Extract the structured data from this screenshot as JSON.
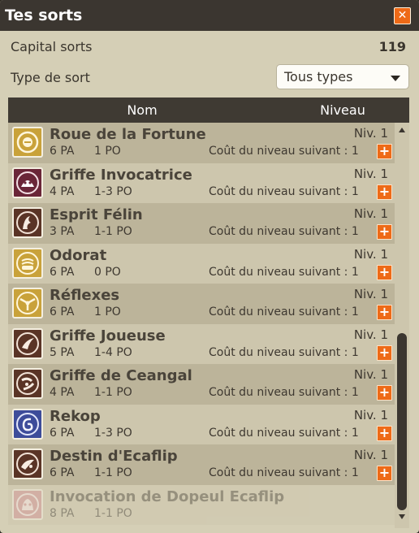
{
  "window": {
    "title": "Tes sorts",
    "close_label": "✕"
  },
  "capital": {
    "label": "Capital sorts",
    "value": "119"
  },
  "type_filter": {
    "label": "Type de sort",
    "selected": "Tous types"
  },
  "columns": {
    "name": "Nom",
    "level": "Niveau"
  },
  "spells": [
    {
      "name": "Roue de la Fortune",
      "pa": "6 PA",
      "po": "1 PO",
      "level": "Niv. 1",
      "cost": "Coût du niveau suivant : 1",
      "icon": "fortune-wheel-icon"
    },
    {
      "name": "Griffe Invocatrice",
      "pa": "4 PA",
      "po": "1-3 PO",
      "level": "Niv. 1",
      "cost": "Coût du niveau suivant : 1",
      "icon": "summoning-claw-icon"
    },
    {
      "name": "Esprit Félin",
      "pa": "3 PA",
      "po": "1-1 PO",
      "level": "Niv. 1",
      "cost": "Coût du niveau suivant : 1",
      "icon": "feline-spirit-icon"
    },
    {
      "name": "Odorat",
      "pa": "6 PA",
      "po": "0 PO",
      "level": "Niv. 1",
      "cost": "Coût du niveau suivant : 1",
      "icon": "smell-icon"
    },
    {
      "name": "Réflexes",
      "pa": "6 PA",
      "po": "1 PO",
      "level": "Niv. 1",
      "cost": "Coût du niveau suivant : 1",
      "icon": "reflexes-icon"
    },
    {
      "name": "Griffe Joueuse",
      "pa": "5 PA",
      "po": "1-4 PO",
      "level": "Niv. 1",
      "cost": "Coût du niveau suivant : 1",
      "icon": "playful-claw-icon"
    },
    {
      "name": "Griffe de Ceangal",
      "pa": "4 PA",
      "po": "1-1 PO",
      "level": "Niv. 1",
      "cost": "Coût du niveau suivant : 1",
      "icon": "ceangal-claw-icon"
    },
    {
      "name": "Rekop",
      "pa": "6 PA",
      "po": "1-3 PO",
      "level": "Niv. 1",
      "cost": "Coût du niveau suivant : 1",
      "icon": "rekop-icon"
    },
    {
      "name": "Destin d'Ecaflip",
      "pa": "6 PA",
      "po": "1-1 PO",
      "level": "Niv. 1",
      "cost": "Coût du niveau suivant : 1",
      "icon": "ecaflip-destiny-icon"
    },
    {
      "name": "Invocation de Dopeul Ecaflip",
      "pa": "8 PA",
      "po": "1-1 PO",
      "level": "",
      "cost": "",
      "icon": "dopeul-summon-icon"
    }
  ],
  "colors": {
    "accent": "#ee6a17",
    "titlebar": "#3b3630",
    "panel": "#d5cfb6",
    "icon_gold": "#c9a23a",
    "icon_maroon": "#6a2638",
    "icon_brown": "#5a3426",
    "icon_blue": "#3d4c9a",
    "icon_pink": "#d08a90"
  }
}
